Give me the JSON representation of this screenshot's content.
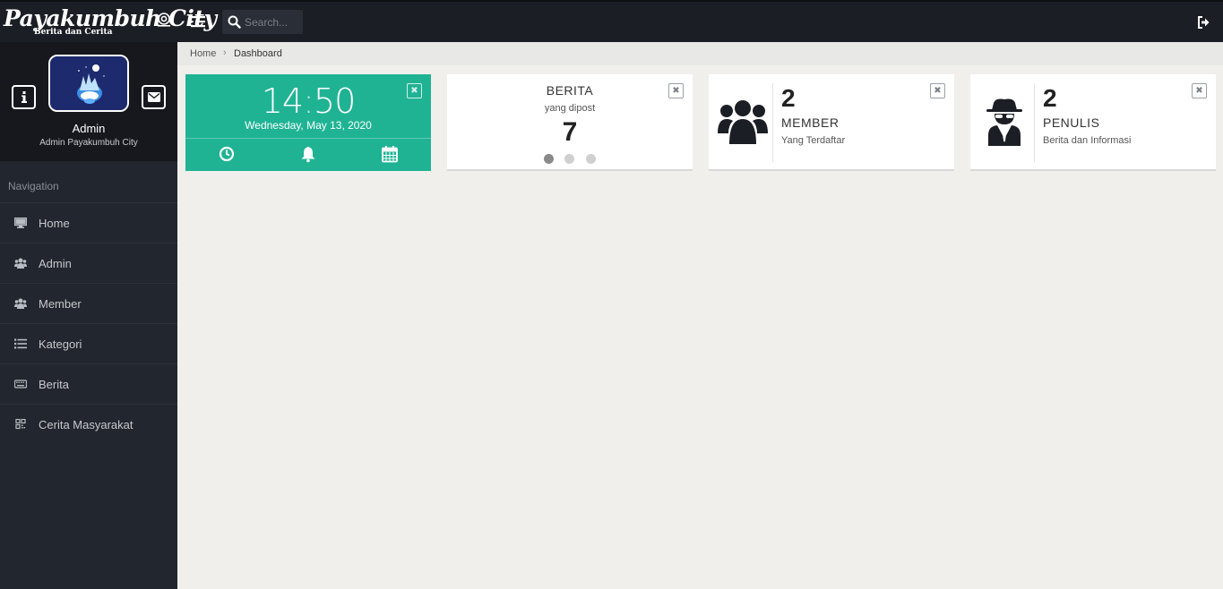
{
  "app": {
    "logo_title": "Payakumbuh City",
    "logo_subtitle": "Berita dan Cerita"
  },
  "topbar": {
    "search_placeholder": "Search...",
    "accent_color": "#1fb394"
  },
  "profile": {
    "name": "Admin",
    "role": "Admin Payakumbuh City"
  },
  "sidebar": {
    "title": "Navigation",
    "items": [
      {
        "label": "Home",
        "icon": "desktop-icon"
      },
      {
        "label": "Admin",
        "icon": "users-icon"
      },
      {
        "label": "Member",
        "icon": "users-icon"
      },
      {
        "label": "Kategori",
        "icon": "list-icon"
      },
      {
        "label": "Berita",
        "icon": "keyboard-icon"
      },
      {
        "label": "Cerita Masyarakat",
        "icon": "qrcode-icon"
      }
    ]
  },
  "breadcrumb": {
    "home": "Home",
    "separator": "›",
    "current": "Dashboard"
  },
  "widgets": {
    "clock": {
      "hours": "14",
      "colon": ":",
      "minutes": "50",
      "date": "Wednesday, May 13, 2020"
    },
    "berita": {
      "title": "BERITA",
      "subtitle": "yang dipost",
      "count": "7"
    },
    "member": {
      "count": "2",
      "title": "MEMBER",
      "subtitle": "Yang Terdaftar"
    },
    "penulis": {
      "count": "2",
      "title": "PENULIS",
      "subtitle": "Berita dan Informasi"
    },
    "close_glyph": "✖"
  }
}
